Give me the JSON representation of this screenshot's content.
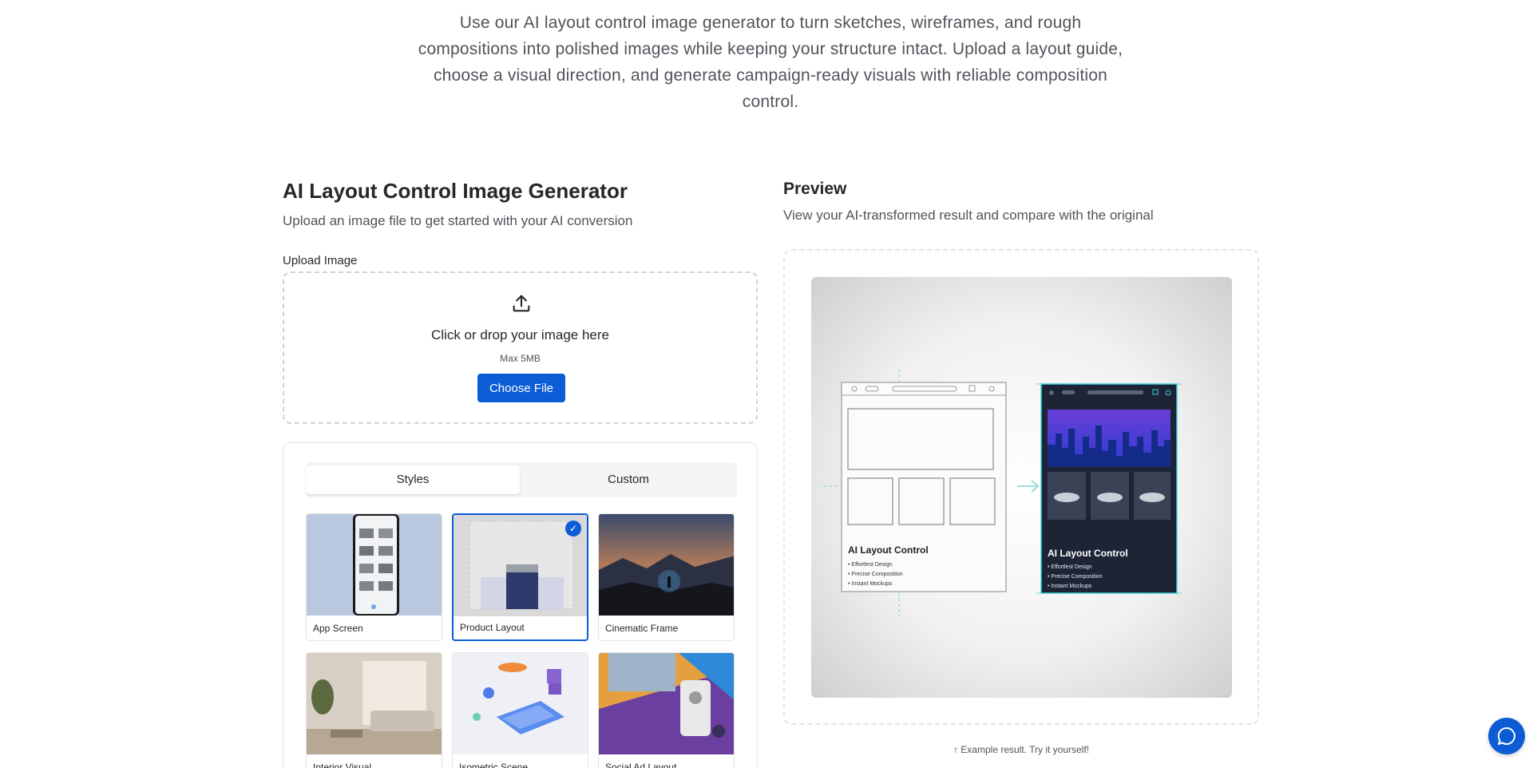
{
  "intro": {
    "text": "Use our AI layout control image generator to turn sketches, wireframes, and rough compositions into polished images while keeping your structure intact. Upload a layout guide, choose a visual direction, and generate campaign-ready visuals with reliable composition control."
  },
  "generator": {
    "title": "AI Layout Control Image Generator",
    "subtitle": "Upload an image file to get started with your AI conversion",
    "upload_label": "Upload Image",
    "dropzone": {
      "icon": "upload-icon",
      "text": "Click or drop your image here",
      "max": "Max 5MB",
      "button": "Choose File"
    },
    "tabs": [
      {
        "label": "Styles",
        "active": true
      },
      {
        "label": "Custom",
        "active": false
      }
    ],
    "styles": [
      {
        "label": "App Screen",
        "selected": false
      },
      {
        "label": "Product Layout",
        "selected": true
      },
      {
        "label": "Cinematic Frame",
        "selected": false
      },
      {
        "label": "Interior Visual",
        "selected": false
      },
      {
        "label": "Isometric Scene",
        "selected": false
      },
      {
        "label": "Social Ad Layout",
        "selected": false
      }
    ]
  },
  "preview": {
    "title": "Preview",
    "subtitle": "View your AI-transformed result and compare with the original",
    "example_note": "↑ Example result. Try it yourself!",
    "sketch_card": {
      "title": "AI Layout Control",
      "bullets": [
        "• Effortlest Design",
        "• Precise Composition",
        "• Instant Mockups"
      ]
    },
    "rendered_card": {
      "title": "AI Layout Control",
      "bullets": [
        "• Effortlest Design",
        "• Precise Composition",
        "• Instant Mockups"
      ]
    }
  },
  "colors": {
    "accent": "#0b5cd5",
    "text": "#27272a",
    "muted": "#52525b",
    "border": "#e4e4e7"
  },
  "chat": {
    "icon": "chat-bubble-icon"
  }
}
